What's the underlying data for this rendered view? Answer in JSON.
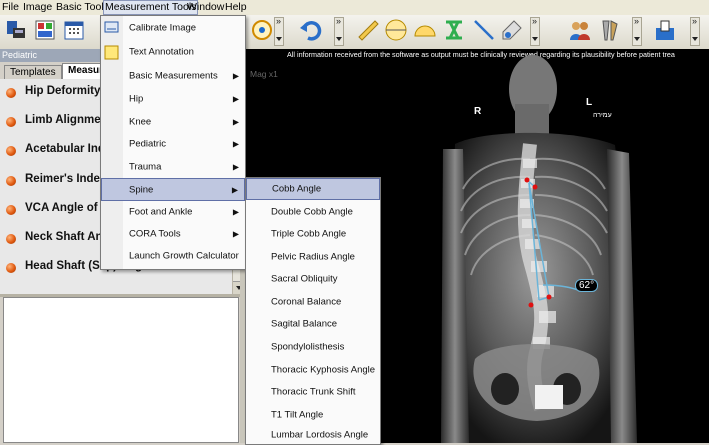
{
  "menubar": {
    "items": [
      "File",
      "Image",
      "Basic Tools",
      "Measurement Tools",
      "Window",
      "Help"
    ]
  },
  "left_panel": {
    "section_label": "Pediatric",
    "tabs": [
      "Templates",
      "Measur"
    ],
    "templates": [
      "Hip Deformity A",
      "Limb Alignment",
      "Acetabular Inde",
      "Reimer's Index",
      "VCA Angle of Le",
      "Neck Shaft Ang",
      "Head Shaft (Slip) Angle"
    ]
  },
  "viewer": {
    "disclaimer": "All information received from the software as output must be clinically reviewed regarding its plausibility before patient trea",
    "mag_label": "Mag x1",
    "marker_right": "R",
    "marker_left": "L",
    "marker_hebrew": "עמירה",
    "angle_value": "62°"
  },
  "measurement_menu": {
    "items": [
      {
        "label": "Calibrate Image",
        "submenu": false
      },
      {
        "label": "Text Annotation",
        "submenu": false
      },
      {
        "label": "Basic Measurements",
        "submenu": true
      },
      {
        "label": "Hip",
        "submenu": true
      },
      {
        "label": "Knee",
        "submenu": true
      },
      {
        "label": "Pediatric",
        "submenu": true
      },
      {
        "label": "Trauma",
        "submenu": true
      },
      {
        "label": "Spine",
        "submenu": true
      },
      {
        "label": "Foot and Ankle",
        "submenu": true
      },
      {
        "label": "CORA Tools",
        "submenu": true
      },
      {
        "label": "Launch Growth Calculator",
        "submenu": false
      }
    ],
    "highlighted": "Spine",
    "submenu_arrow": "▶"
  },
  "spine_menu": {
    "items": [
      "Cobb Angle",
      "Double Cobb Angle",
      "Triple Cobb Angle",
      "Pelvic Radius Angle",
      "Sacral Obliquity",
      "Coronal Balance",
      "Sagital Balance",
      "Spondylolisthesis",
      "Thoracic Kyphosis Angle",
      "Thoracic Trunk Shift",
      "T1 Tilt Angle",
      "Lumbar Lordosis Angle"
    ],
    "highlighted": "Cobb Angle"
  },
  "colors": {
    "menu_highlight": "#bfc7e0",
    "template_dot": "#e05a10",
    "measure_line": "#6bb4d8",
    "measure_point": "#e01010"
  }
}
